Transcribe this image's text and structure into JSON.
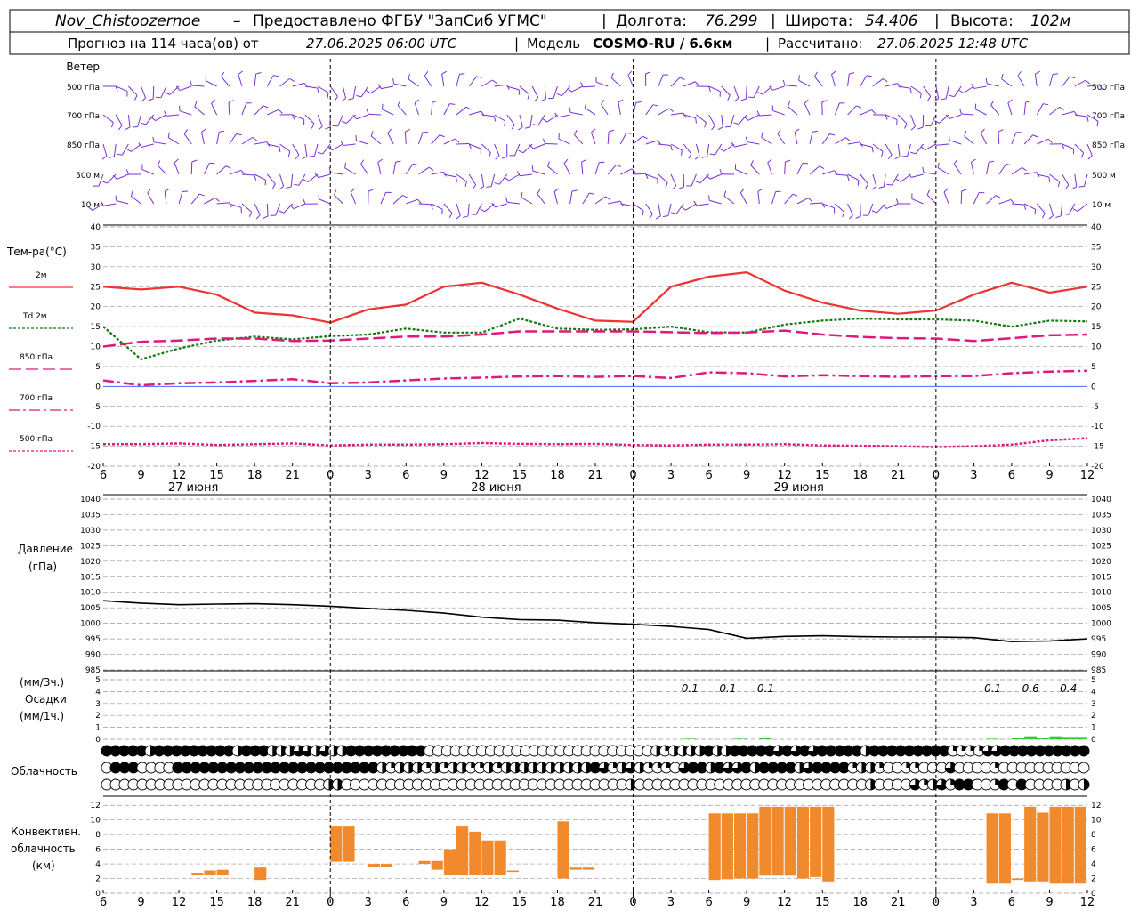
{
  "header": {
    "station": "Nov_Chistoozernoe",
    "provider": "Предоставлено ФГБУ \"ЗапСиб УГМС\"",
    "lon_label": "Долгота:",
    "lon_value": "76.299",
    "lat_label": "Широта:",
    "lat_value": "54.406",
    "alt_label": "Высота:",
    "alt_value": "102м",
    "forecast_prefix": "Прогноз на 114 часа(ов) от",
    "forecast_time": "27.06.2025 06:00 UTC",
    "model_label": "Модель",
    "model_name": "COSMO-RU / 6.6км",
    "calc_label": "Рассчитано:",
    "calc_time": "27.06.2025 12:48 UTC"
  },
  "colors": {
    "wind": "#7b2fd6",
    "t2m": "#ee3333",
    "td2m": "#117711",
    "t850": "#e0197d",
    "t700": "#e0197d",
    "t500": "#e0197d",
    "precip": "#33cc33",
    "conv": "#f08a2c",
    "pressure": "#000000",
    "grid": "#999999"
  },
  "x_axis": {
    "ticks": [
      "6",
      "9",
      "12",
      "15",
      "18",
      "21",
      "0",
      "3",
      "6",
      "9",
      "12",
      "15",
      "18",
      "21",
      "0",
      "3",
      "6",
      "9",
      "12",
      "15",
      "18",
      "21",
      "0",
      "3",
      "6",
      "9",
      "12"
    ],
    "dates": [
      "27 июня",
      "28 июня",
      "29 июня"
    ]
  },
  "wind_panel": {
    "title": "Ветер",
    "levels": [
      "500 гПа",
      "700 гПа",
      "850 гПа",
      "500 м",
      "10 м"
    ]
  },
  "chart_data": [
    {
      "type": "line",
      "title": "Тем-ра(°C)",
      "ylim": [
        -20,
        40
      ],
      "yticks": [
        "40",
        "35",
        "30",
        "25",
        "20",
        "15",
        "10",
        "5",
        "0",
        "-5",
        "-10",
        "-15",
        "-20"
      ],
      "x_hours": [
        0,
        3,
        6,
        9,
        12,
        15,
        18,
        21,
        24,
        27,
        30,
        33,
        36,
        39,
        42,
        45,
        48,
        51,
        54,
        57,
        60,
        63,
        66,
        69,
        72,
        75,
        78
      ],
      "series": [
        {
          "name": "2м",
          "values": [
            25,
            24.3,
            25,
            23,
            18.5,
            17.8,
            16,
            19.3,
            20.5,
            25,
            26,
            23,
            19.5,
            16.5,
            16.2,
            25,
            27.5,
            28.6,
            24,
            21,
            19,
            18.2,
            19,
            23,
            26,
            23.5,
            25
          ]
        },
        {
          "name": "Td 2м",
          "values": [
            15,
            6.8,
            9.5,
            11.5,
            12.5,
            11.8,
            12.6,
            13,
            14.5,
            13.5,
            13.5,
            17,
            14.5,
            14.2,
            14.3,
            15,
            13.6,
            13.5,
            15.5,
            16.5,
            17,
            16.8,
            16.8,
            16.5,
            15,
            16.5,
            16.3
          ]
        },
        {
          "name": "850 гПа",
          "values": [
            10,
            11.2,
            11.5,
            12,
            12,
            11.4,
            11.5,
            12,
            12.5,
            12.5,
            13,
            13.8,
            13.8,
            13.8,
            13.8,
            13.6,
            13.4,
            13.5,
            14,
            13,
            12.4,
            12.1,
            12,
            11.4,
            12.1,
            12.8,
            13
          ]
        },
        {
          "name": "700 гПа",
          "values": [
            1.5,
            0.3,
            0.8,
            1,
            1.4,
            1.8,
            0.8,
            1,
            1.5,
            2,
            2.2,
            2.5,
            2.6,
            2.4,
            2.6,
            2.1,
            3.5,
            3.3,
            2.5,
            2.8,
            2.6,
            2.4,
            2.6,
            2.6,
            3.3,
            3.7,
            3.9
          ]
        },
        {
          "name": "500 гПа",
          "values": [
            -14.5,
            -14.5,
            -14.3,
            -14.7,
            -14.5,
            -14.3,
            -14.8,
            -14.6,
            -14.6,
            -14.5,
            -14.2,
            -14.4,
            -14.5,
            -14.4,
            -14.7,
            -14.8,
            -14.6,
            -14.6,
            -14.5,
            -14.8,
            -14.9,
            -15,
            -15.2,
            -15,
            -14.6,
            -13.5,
            -13
          ]
        }
      ]
    },
    {
      "type": "line",
      "title": "Давление",
      "unit": "(гПа)",
      "ylim": [
        985,
        1040
      ],
      "yticks": [
        "1040",
        "1035",
        "1030",
        "1025",
        "1020",
        "1015",
        "1010",
        "1005",
        "1000",
        "995",
        "990",
        "985"
      ],
      "x_hours": [
        0,
        3,
        6,
        9,
        12,
        15,
        18,
        21,
        24,
        27,
        30,
        33,
        36,
        39,
        42,
        45,
        48,
        51,
        54,
        57,
        60,
        63,
        66,
        69,
        72,
        75,
        78
      ],
      "series": [
        {
          "name": "",
          "values": [
            1007.3,
            1006.5,
            1006,
            1006.2,
            1006.3,
            1006,
            1005.5,
            1004.8,
            1004.2,
            1003.3,
            1002,
            1001.2,
            1001,
            1000.2,
            999.7,
            999,
            998,
            995.2,
            995.8,
            996,
            995.7,
            995.6,
            995.6,
            995.4,
            994.1,
            994.3,
            995
          ]
        }
      ]
    },
    {
      "type": "bar",
      "title": "Осадки",
      "unit_top": "(мм/3ч.)",
      "unit_bottom": "(мм/1ч.)",
      "ylim": [
        0,
        5
      ],
      "yticks": [
        "5",
        "4",
        "3",
        "2",
        "1",
        "0"
      ],
      "labels_3h": [
        {
          "x": 46.5,
          "text": "0.1"
        },
        {
          "x": 49.5,
          "text": "0.1"
        },
        {
          "x": 52.5,
          "text": "0.1"
        },
        {
          "x": 70.5,
          "text": "0.1"
        },
        {
          "x": 73.5,
          "text": "0.6"
        },
        {
          "x": 76.5,
          "text": "0.4"
        }
      ],
      "hourly_values": [
        {
          "x": 46.5,
          "v": 0.05
        },
        {
          "x": 50.5,
          "v": 0.05
        },
        {
          "x": 52.5,
          "v": 0.1
        },
        {
          "x": 70.5,
          "v": 0.05
        },
        {
          "x": 72.5,
          "v": 0.15
        },
        {
          "x": 73.5,
          "v": 0.25
        },
        {
          "x": 74.5,
          "v": 0.15
        },
        {
          "x": 75.5,
          "v": 0.25
        },
        {
          "x": 76.5,
          "v": 0.2
        },
        {
          "x": 77.5,
          "v": 0.2
        }
      ]
    },
    {
      "type": "table",
      "title": "Облачность",
      "rows_desc": "3 rows (high, middle, low) of cloud-cover symbols, hourly; value = cover fraction 0..1",
      "rows": [
        [
          1,
          1,
          1,
          1,
          1,
          0.5,
          1,
          1,
          1,
          1,
          1,
          1,
          1,
          1,
          1,
          0.5,
          1,
          1,
          1,
          0.5,
          0.5,
          0.5,
          0.75,
          0.75,
          0.5,
          0.75,
          0.5,
          0.5,
          1,
          1,
          1,
          1,
          1,
          1,
          1,
          1,
          1,
          0,
          0,
          0,
          0,
          0,
          0,
          0,
          0,
          0,
          0,
          0,
          0,
          0,
          0,
          0,
          0,
          0,
          0,
          0,
          0,
          0,
          0,
          0,
          0,
          0,
          0,
          0.5,
          0.25,
          0.5,
          0.5,
          0.5,
          0.5,
          1,
          0.5,
          0.5,
          1,
          1,
          1,
          1,
          1,
          0.75,
          1,
          0.75,
          1,
          0.75,
          1,
          1,
          1,
          1,
          1,
          0.5,
          1,
          1,
          1,
          1,
          1,
          1,
          1,
          1,
          1,
          0.25,
          0.25,
          0.25,
          0.25,
          0.75,
          0.75,
          1,
          1,
          1,
          1,
          1,
          1,
          1,
          1,
          1,
          1
        ],
        [
          0,
          1,
          1,
          1,
          0,
          0,
          0,
          0,
          1,
          1,
          1,
          1,
          1,
          1,
          1,
          1,
          1,
          1,
          1,
          1,
          1,
          1,
          1,
          1,
          1,
          1,
          1,
          1,
          1,
          1,
          1,
          0.5,
          0.25,
          0.5,
          0.5,
          0.5,
          0.25,
          0.5,
          0.25,
          0.5,
          0.5,
          0.25,
          0.25,
          0.5,
          0.25,
          0.5,
          0.5,
          0.5,
          0.5,
          0.5,
          0.5,
          0.5,
          0.5,
          0.5,
          0.5,
          1,
          0.75,
          0.25,
          0.5,
          0.75,
          0.5,
          0.25,
          0.25,
          0.25,
          0,
          0.75,
          1,
          1,
          0.5,
          1,
          0.75,
          0.75,
          1,
          0.5,
          1,
          1,
          1,
          1,
          0.5,
          0.75,
          1,
          1,
          1,
          1,
          0.25,
          0.5,
          0.5,
          0.25,
          0,
          0,
          0.25,
          0.25,
          0,
          0,
          0,
          0.75,
          0,
          0,
          0,
          0,
          0.25,
          0,
          0,
          0,
          0,
          0,
          0,
          0,
          0,
          0,
          0
        ],
        [
          0,
          0,
          0,
          0,
          0,
          0,
          0,
          0,
          0,
          0,
          0,
          0,
          0,
          0,
          0,
          0,
          0,
          0,
          0,
          0,
          0,
          0,
          0,
          0,
          0,
          0.5,
          0.5,
          0,
          0,
          0,
          0,
          0,
          0,
          0,
          0,
          0,
          0,
          0,
          0,
          0,
          0,
          0,
          0,
          0,
          0,
          0,
          0,
          0,
          0,
          0,
          0,
          0,
          0,
          0,
          0,
          0,
          0,
          0,
          0,
          0.5,
          0,
          0,
          0,
          0,
          0,
          0,
          0,
          0,
          0,
          0,
          0,
          0,
          0,
          0,
          0,
          0,
          0,
          0,
          0,
          0,
          0,
          0,
          0,
          0,
          0,
          0,
          0.5,
          0,
          0,
          0,
          0,
          0.75,
          0.25,
          0.5,
          0.75,
          0.25,
          1,
          1,
          0,
          0,
          0.25,
          1,
          0,
          1,
          0,
          0,
          0,
          0,
          0.5,
          0,
          0.5
        ]
      ]
    },
    {
      "type": "bar",
      "title": "Конвективн. облачность",
      "unit": "(км)",
      "ylim": [
        0,
        13
      ],
      "yticks": [
        "12",
        "10",
        "8",
        "6",
        "4",
        "2",
        "0"
      ],
      "bars": [
        {
          "x0": 7,
          "x1": 8,
          "lo": 2.5,
          "hi": 2.8
        },
        {
          "x0": 8,
          "x1": 9,
          "lo": 2.5,
          "hi": 3.1
        },
        {
          "x0": 9,
          "x1": 10,
          "lo": 2.5,
          "hi": 3.2
        },
        {
          "x0": 12,
          "x1": 13,
          "lo": 1.8,
          "hi": 3.5
        },
        {
          "x0": 18,
          "x1": 19,
          "lo": 4.3,
          "hi": 9.1
        },
        {
          "x0": 19,
          "x1": 20,
          "lo": 4.3,
          "hi": 9.1
        },
        {
          "x0": 21,
          "x1": 22,
          "lo": 3.6,
          "hi": 4.0
        },
        {
          "x0": 22,
          "x1": 23,
          "lo": 3.6,
          "hi": 4.0
        },
        {
          "x0": 25,
          "x1": 26,
          "lo": 4.0,
          "hi": 4.4
        },
        {
          "x0": 26,
          "x1": 27,
          "lo": 3.2,
          "hi": 4.4
        },
        {
          "x0": 27,
          "x1": 28,
          "lo": 2.5,
          "hi": 6.0
        },
        {
          "x0": 28,
          "x1": 29,
          "lo": 2.5,
          "hi": 9.1
        },
        {
          "x0": 29,
          "x1": 30,
          "lo": 2.5,
          "hi": 8.4
        },
        {
          "x0": 30,
          "x1": 31,
          "lo": 2.5,
          "hi": 7.2
        },
        {
          "x0": 31,
          "x1": 32,
          "lo": 2.5,
          "hi": 7.2
        },
        {
          "x0": 32,
          "x1": 33,
          "lo": 2.9,
          "hi": 3.1
        },
        {
          "x0": 36,
          "x1": 37,
          "lo": 2.0,
          "hi": 9.8
        },
        {
          "x0": 37,
          "x1": 38,
          "lo": 3.2,
          "hi": 3.5
        },
        {
          "x0": 38,
          "x1": 39,
          "lo": 3.2,
          "hi": 3.5
        },
        {
          "x0": 48,
          "x1": 49,
          "lo": 1.8,
          "hi": 10.9
        },
        {
          "x0": 49,
          "x1": 50,
          "lo": 1.9,
          "hi": 10.9
        },
        {
          "x0": 50,
          "x1": 51,
          "lo": 2.0,
          "hi": 10.9
        },
        {
          "x0": 51,
          "x1": 52,
          "lo": 2.0,
          "hi": 10.9
        },
        {
          "x0": 52,
          "x1": 53,
          "lo": 2.4,
          "hi": 11.8
        },
        {
          "x0": 53,
          "x1": 54,
          "lo": 2.4,
          "hi": 11.8
        },
        {
          "x0": 54,
          "x1": 55,
          "lo": 2.4,
          "hi": 11.8
        },
        {
          "x0": 55,
          "x1": 56,
          "lo": 2.0,
          "hi": 11.8
        },
        {
          "x0": 56,
          "x1": 57,
          "lo": 2.2,
          "hi": 11.8
        },
        {
          "x0": 57,
          "x1": 58,
          "lo": 1.6,
          "hi": 11.8
        },
        {
          "x0": 70,
          "x1": 71,
          "lo": 1.3,
          "hi": 10.9
        },
        {
          "x0": 71,
          "x1": 72,
          "lo": 1.3,
          "hi": 10.9
        },
        {
          "x0": 72,
          "x1": 73,
          "lo": 1.8,
          "hi": 2.0
        },
        {
          "x0": 73,
          "x1": 74,
          "lo": 1.6,
          "hi": 11.8
        },
        {
          "x0": 74,
          "x1": 75,
          "lo": 1.6,
          "hi": 11.0
        },
        {
          "x0": 75,
          "x1": 76,
          "lo": 1.3,
          "hi": 11.8
        },
        {
          "x0": 76,
          "x1": 77,
          "lo": 1.3,
          "hi": 11.8
        },
        {
          "x0": 77,
          "x1": 78,
          "lo": 1.3,
          "hi": 11.8
        }
      ]
    }
  ]
}
